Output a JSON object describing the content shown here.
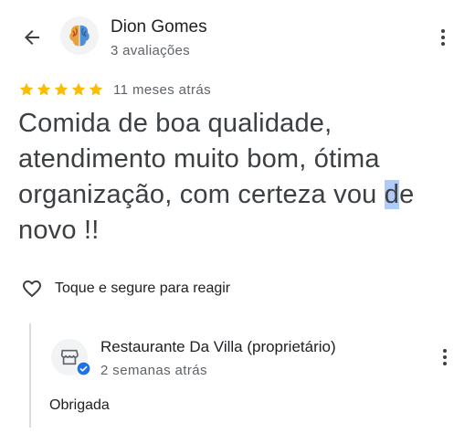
{
  "review": {
    "reviewer_name": "Dion Gomes",
    "reviewer_subtitle": "3 avaliações",
    "rating": 5,
    "rating_max": 5,
    "time_ago": "11 meses atrás",
    "text_before_selection": "Comida de boa qualidade, atendimento muito bom, ótima organização, com certeza vou ",
    "text_selected": "d",
    "text_after_selection": "e novo !!",
    "react_label": "Toque e segure para reagir"
  },
  "reply": {
    "owner_name": "Restaurante Da Villa (proprietário)",
    "time_ago": "2 semanas atrás",
    "text": "Obrigada"
  },
  "icons": {
    "back": "arrow-back-icon",
    "more": "more-vert-icon",
    "star": "star-icon",
    "heart": "heart-outline-icon",
    "store": "storefront-icon",
    "verified": "verified-check-icon"
  },
  "colors": {
    "star": "#fbbc04",
    "verified": "#1a73e8",
    "selection": "#aecbfa",
    "secondary_text": "#5f6368"
  }
}
